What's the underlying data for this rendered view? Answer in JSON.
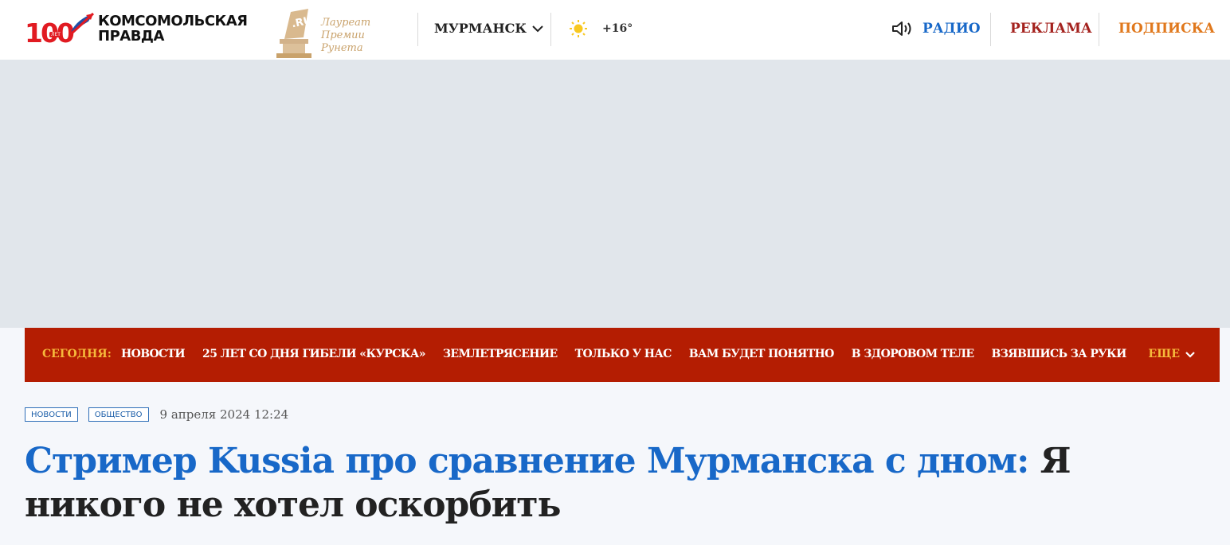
{
  "header": {
    "logo": {
      "number": "100",
      "let": "ЛЕТ",
      "brand_line1": "КОМСОМОЛЬСКАЯ",
      "brand_line2": "ПРАВДА"
    },
    "award": {
      "line1": "Лауреат",
      "line2": "Премии Рунета",
      "badge": ".RU"
    },
    "city": "МУРМАНСК",
    "weather": {
      "icon": "sun-icon",
      "temp": "+16°"
    },
    "radio": "РАДИО",
    "ads": "РЕКЛАМА",
    "subscribe": "ПОДПИСКА"
  },
  "topics": {
    "today_label": "СЕГОДНЯ:",
    "items": [
      "НОВОСТИ",
      "25 ЛЕТ СО ДНЯ ГИБЕЛИ «КУРСКА»",
      "ЗЕМЛЕТРЯСЕНИЕ",
      "ТОЛЬКО У НАС",
      "ВАМ БУДЕТ ПОНЯТНО",
      "В ЗДОРОВОМ ТЕЛЕ",
      "ВЗЯВШИСЬ ЗА РУКИ"
    ],
    "more": "ЕЩЕ"
  },
  "article": {
    "tags": [
      "НОВОСТИ",
      "ОБЩЕСТВО"
    ],
    "date": "9 апреля 2024 12:24",
    "title_highlight": "Стример Kussia про сравнение Мурманска с дном:",
    "title_rest": " Я никого не хотел оскорбить"
  },
  "colors": {
    "brand_red": "#e11b22",
    "nav_bg": "#b41d02",
    "nav_accent": "#f6b93b",
    "link_blue": "#1868c8",
    "ads_red": "#a4221e",
    "subscribe_orange": "#e0781c"
  }
}
